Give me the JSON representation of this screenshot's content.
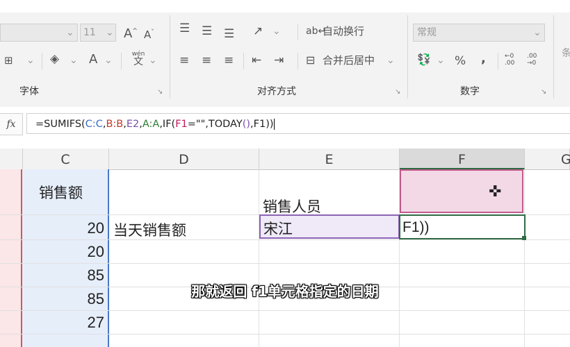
{
  "ribbon": {
    "font_size_value": "11",
    "grow_font": "A",
    "shrink_font": "A",
    "font_color_glyph": "A",
    "wen_top": "wén",
    "wen_bottom": "文",
    "wrap_text_label": "自动换行",
    "merge_center_label": "合并后居中",
    "number_format_value": "常规",
    "percent_label": "%",
    "comma_label": ",",
    "inc_decimal_label": "←0 .00",
    "dec_decimal_label": ".00 →0",
    "group_font": "字体",
    "group_alignment": "对齐方式",
    "group_number": "数字",
    "right_edge_glyph": "条"
  },
  "formula_bar": {
    "fx_label": "fx",
    "formula_tokens": [
      {
        "t": "=SUMIFS(",
        "c": "#222222"
      },
      {
        "t": "C:C",
        "c": "#3a6fc4"
      },
      {
        "t": ",",
        "c": "#222222"
      },
      {
        "t": "B:B",
        "c": "#c0392b"
      },
      {
        "t": ",",
        "c": "#222222"
      },
      {
        "t": "E2",
        "c": "#7b4fa8"
      },
      {
        "t": ",",
        "c": "#222222"
      },
      {
        "t": "A:A",
        "c": "#2e7d32"
      },
      {
        "t": ",IF(",
        "c": "#222222"
      },
      {
        "t": "F1",
        "c": "#c2185b"
      },
      {
        "t": "=\"\",TODAY",
        "c": "#222222"
      },
      {
        "t": "()",
        "c": "#7b4fa8"
      },
      {
        "t": ",F1)",
        "c": "#222222"
      },
      {
        "t": ")",
        "c": "#222222"
      }
    ]
  },
  "columns": [
    "C",
    "D",
    "E",
    "F",
    "G"
  ],
  "cells": {
    "c1": "销售额",
    "e1": "销售人员",
    "c2": "20",
    "d2": "当天销售额",
    "e2": "宋江",
    "f2": "F1))",
    "c3": "20",
    "c4": "85",
    "c5": "85",
    "c6": "27"
  },
  "subtitle": "那就返回 f1单元格指定的日期",
  "colors": {
    "f1_fill": "#f3d9e6",
    "e2_fill": "#efe9f8",
    "c_col_border": "#4a78c8",
    "b_col_border": "#d2565c",
    "f2_border": "#2f6b44",
    "e2_border": "#8b63b6"
  }
}
